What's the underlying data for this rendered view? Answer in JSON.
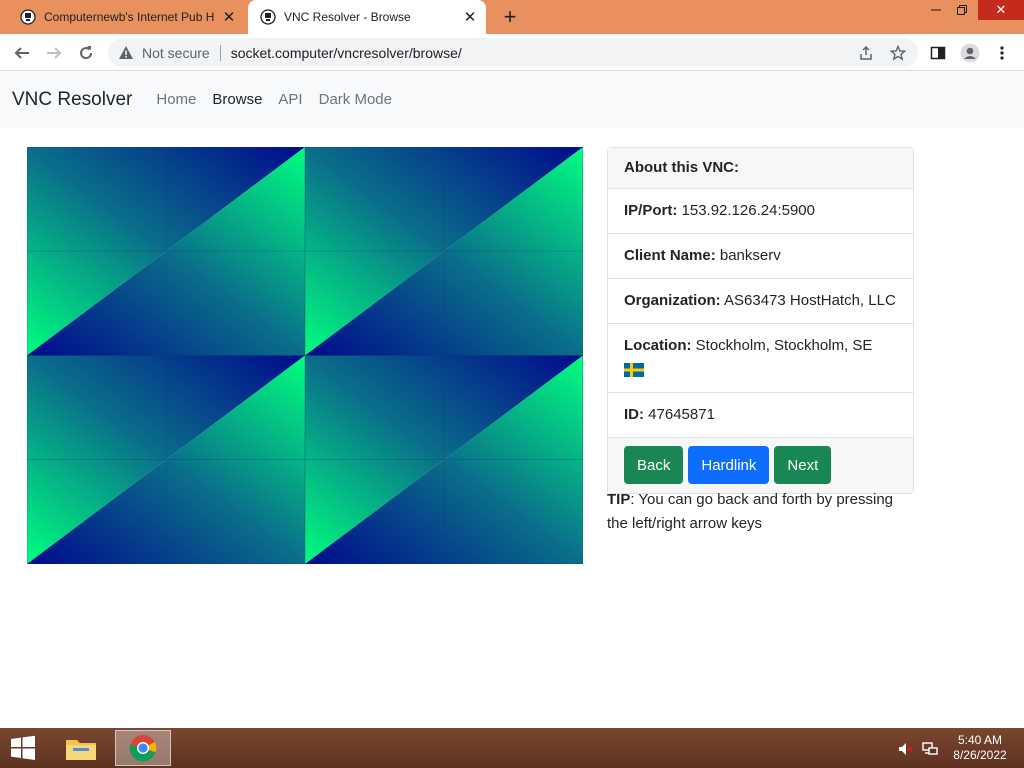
{
  "browser": {
    "tabs": [
      {
        "title": "Computernewb's Internet Pub H",
        "active": false,
        "icon": "pub-favicon-icon"
      },
      {
        "title": "VNC Resolver - Browse",
        "active": true,
        "icon": "pub-favicon-icon"
      }
    ],
    "security_label": "Not secure",
    "url": "socket.computer/vncresolver/browse/"
  },
  "site": {
    "brand": "VNC Resolver",
    "nav": [
      "Home",
      "Browse",
      "API",
      "Dark Mode"
    ],
    "active_nav": "Browse"
  },
  "card": {
    "header": "About this VNC:",
    "rows": [
      {
        "label": "IP/Port:",
        "value": "153.92.126.24:5900"
      },
      {
        "label": "Client Name:",
        "value": "bankserv"
      },
      {
        "label": "Organization:",
        "value": "AS63473 HostHatch, LLC"
      },
      {
        "label": "Location:",
        "value": "Stockholm, Stockholm, SE"
      },
      {
        "label": "ID:",
        "value": "47645871"
      }
    ],
    "buttons": {
      "back": "Back",
      "hardlink": "Hardlink",
      "next": "Next"
    }
  },
  "tip": {
    "label": "TIP",
    "text": ": You can go back and forth by pressing the left/right arrow keys"
  },
  "taskbar": {
    "time": "5:40 AM",
    "date": "8/26/2022"
  },
  "colors": {
    "tab_strip": "#e8915f",
    "taskbar": "#6b3a24",
    "button_green": "#198754",
    "button_blue": "#0d6efd",
    "vnc_dark": "#000a8c",
    "vnc_light": "#00ff80",
    "flag_blue": "#006aa7",
    "flag_yellow": "#fecc00"
  }
}
